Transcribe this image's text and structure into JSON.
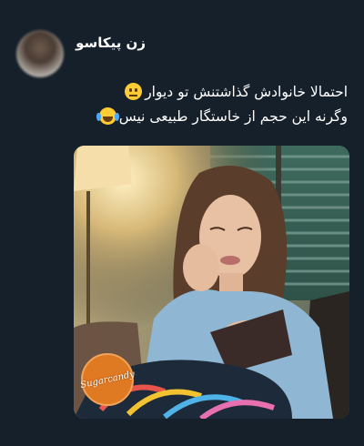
{
  "tweet": {
    "display_name": "زن پیکاسو",
    "text_line1": "احتمالا خانوادش گذاشتنش تو دیوار",
    "text_line2": "وگرنه این حجم از خاستگار طبیعی نیس",
    "emoji_line1": "neutral-face-icon",
    "emoji_line2": "tears-of-joy-icon"
  },
  "media": {
    "watermark_text": "Sugarcandy"
  },
  "colors": {
    "background": "#15202b",
    "text": "#ffffff",
    "emoji": "#ffcc33"
  }
}
